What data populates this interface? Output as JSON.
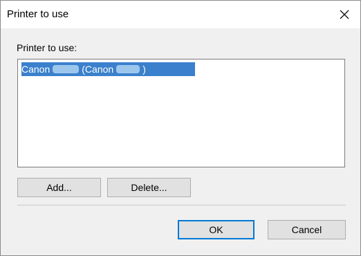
{
  "window": {
    "title": "Printer to use",
    "close_icon": "close-icon"
  },
  "printer_list": {
    "label": "Printer to use:",
    "items": [
      {
        "name_visible": "Canon",
        "paren_visible": "(Canon",
        "suffix": ")",
        "selected": true
      }
    ]
  },
  "buttons": {
    "add": "Add...",
    "delete": "Delete...",
    "ok": "OK",
    "cancel": "Cancel"
  },
  "colors": {
    "selection": "#3a80cc",
    "default_button_border": "#0078d7"
  }
}
